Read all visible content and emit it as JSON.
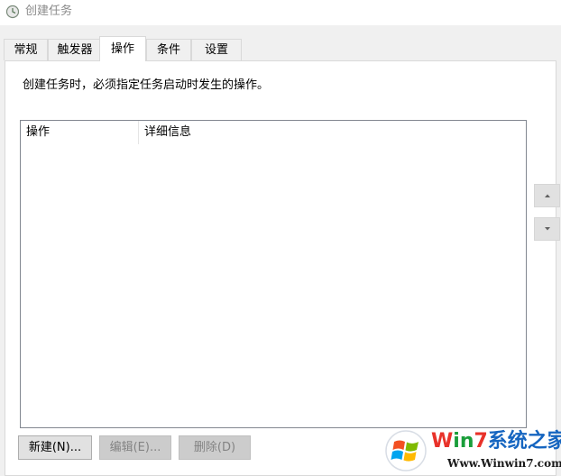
{
  "window": {
    "title": "创建任务"
  },
  "tabs": [
    {
      "label": "常规",
      "active": false
    },
    {
      "label": "触发器",
      "active": false
    },
    {
      "label": "操作",
      "active": true
    },
    {
      "label": "条件",
      "active": false
    },
    {
      "label": "设置",
      "active": false
    }
  ],
  "panel": {
    "description": "创建任务时，必须指定任务启动时发生的操作。"
  },
  "actions_list": {
    "columns": [
      "操作",
      "详细信息"
    ],
    "rows": []
  },
  "buttons": {
    "new": {
      "label": "新建(N)...",
      "enabled": true
    },
    "edit": {
      "label": "编辑(E)...",
      "enabled": false
    },
    "delete": {
      "label": "删除(D)",
      "enabled": false
    }
  },
  "watermark": {
    "title_w": "W",
    "title_in": "in",
    "title_7": "7",
    "title_rest": "系统之家",
    "url": "Www.Winwin7.com"
  },
  "colors": {
    "watermark_red": "#e8322a",
    "watermark_green": "#1a9e3a",
    "watermark_blue": "#1565c0"
  }
}
